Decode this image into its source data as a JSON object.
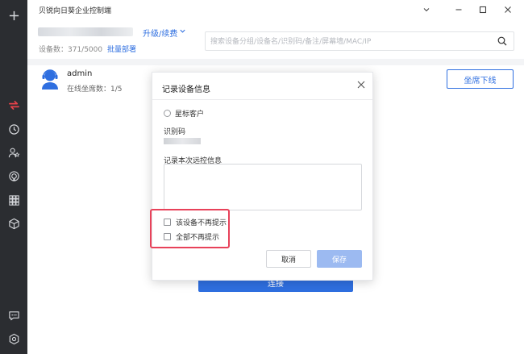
{
  "app": {
    "title": "贝锐向日葵企业控制端"
  },
  "header": {
    "upgrade_label": "升级/续费",
    "device_count": "设备数：371/5000",
    "batch_deploy": "批量部署",
    "search_placeholder": "搜索设备分组/设备名/识别码/备注/屏幕墙/MAC/IP"
  },
  "user": {
    "name": "admin",
    "online_seats": "在线坐席数：1/5",
    "seat_offline_button": "坐席下线"
  },
  "background_button": {
    "label": "连接"
  },
  "modal": {
    "title": "记录设备信息",
    "star_customer": "星标客户",
    "identification_code_label": "识别码",
    "record_label": "记录本次远控信息",
    "record_value": "",
    "dont_remind_device": "该设备不再提示",
    "dont_remind_all": "全部不再提示",
    "cancel": "取消",
    "save": "保存"
  },
  "sidebar": {
    "icons": [
      "add-icon",
      "transfer-icon",
      "history-icon",
      "contacts-icon",
      "remote-icon",
      "apps-icon",
      "cube-icon",
      "message-icon",
      "settings-icon"
    ]
  },
  "colors": {
    "accent": "#2f6fe0",
    "sidebar_bg": "#2b2d31",
    "active_icon": "#e8424a",
    "highlight": "#e8425a",
    "save_disabled": "#9cbaf1"
  }
}
